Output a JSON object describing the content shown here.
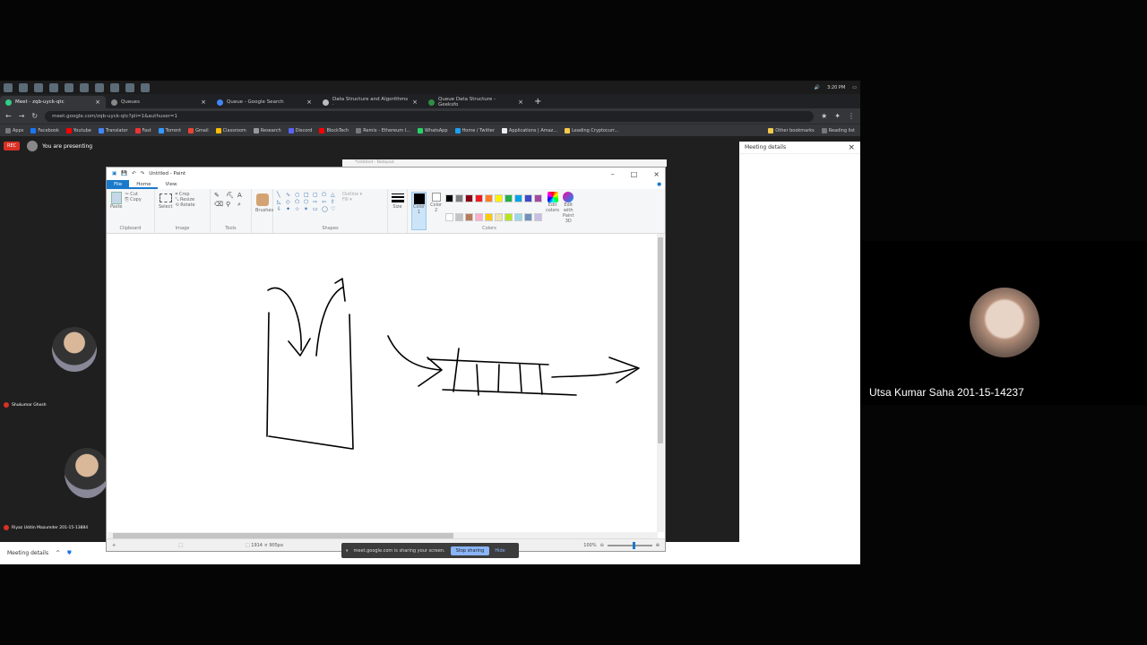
{
  "taskbar": {
    "time": "3:20 PM",
    "icons": [
      "windows-icon",
      "search-icon",
      "cortana-icon",
      "taskview-icon",
      "explorer-icon",
      "chrome-icon",
      "store-icon",
      "notepad-icon",
      "terminal-icon",
      "paint-icon"
    ]
  },
  "tabs": [
    {
      "label": "Meet - zqb-uyck-qtc",
      "active": true
    },
    {
      "label": "Queues",
      "active": false
    },
    {
      "label": "Queue - Google Search",
      "active": false
    },
    {
      "label": "Data Structure and Algorithms ·",
      "active": false
    },
    {
      "label": "Queue Data Structure - Geeksfo",
      "active": false
    }
  ],
  "omnibox": {
    "url": "meet.google.com/zqb-uyck-qtc?pli=1&authuser=1"
  },
  "bookmarks": [
    "Apps",
    "Facebook",
    "Youtube",
    "Translator",
    "Fast",
    "Torrent",
    "Gmail",
    "Classroom",
    "Research",
    "Discord",
    "BlockTech",
    "Remix - Ethereum I...",
    "WhatsApp",
    "Home / Twitter",
    "Applications | Amaz...",
    "Leading Cryptocurr..."
  ],
  "bookmarks_right": [
    "Other bookmarks",
    "Reading list"
  ],
  "meet": {
    "rec": "REC",
    "presenting": "You are presenting",
    "panel_title": "Meeting details",
    "bottom_label": "Meeting details",
    "participants": [
      {
        "name": "Shukumar Ghosh"
      },
      {
        "name": "Riyaz Uddin Mazumder 201-15-13884"
      }
    ],
    "share_text": "meet.google.com is sharing your screen.",
    "stop_sharing": "Stop sharing",
    "hide": "Hide"
  },
  "paint": {
    "title": "Untitled - Paint",
    "tabs": [
      "File",
      "Home",
      "View"
    ],
    "groups": {
      "clipboard": {
        "label": "Clipboard",
        "paste": "Paste",
        "cut": "Cut",
        "copy": "Copy"
      },
      "image": {
        "label": "Image",
        "select": "Select",
        "crop": "Crop",
        "resize": "Resize",
        "rotate": "Rotate"
      },
      "tools": {
        "label": "Tools"
      },
      "brushes": {
        "label": "Brushes"
      },
      "shapes": {
        "label": "Shapes",
        "outline": "Outline",
        "fill": "Fill"
      },
      "size": {
        "label": "Size"
      },
      "colors": {
        "label": "Colors",
        "color1": "Color 1",
        "color2": "Color 2",
        "edit": "Edit colors",
        "paint3d": "Edit with Paint 3D"
      }
    },
    "palette": [
      "#000000",
      "#7f7f7f",
      "#880015",
      "#ed1c24",
      "#ff7f27",
      "#fff200",
      "#22b14c",
      "#00a2e8",
      "#3f48cc",
      "#a349a4",
      "#ffffff",
      "#c3c3c3",
      "#b97a57",
      "#ffaec9",
      "#ffc90e",
      "#efe4b0",
      "#b5e61d",
      "#99d9ea",
      "#7092be",
      "#c8bfe7"
    ],
    "status": {
      "dimensions": "1914 × 905px",
      "zoom": "100%"
    }
  },
  "notepad_ghost": "*Untitled - Notepad",
  "right_tile": {
    "name": "Utsa Kumar Saha 201-15-14237"
  }
}
